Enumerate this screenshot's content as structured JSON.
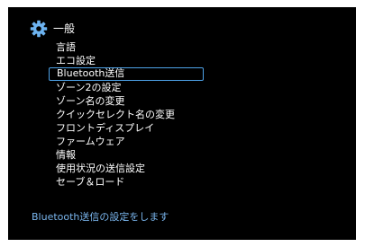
{
  "header": {
    "icon": "gear-icon",
    "title": "一般"
  },
  "menu": {
    "selected_index": 2,
    "items": [
      {
        "label": "言語"
      },
      {
        "label": "エコ設定"
      },
      {
        "label": "Bluetooth送信"
      },
      {
        "label": "ゾーン2の設定"
      },
      {
        "label": "ゾーン名の変更"
      },
      {
        "label": "クイックセレクト名の変更"
      },
      {
        "label": "フロントディスプレイ"
      },
      {
        "label": "ファームウェア"
      },
      {
        "label": "情報"
      },
      {
        "label": "使用状況の送信設定"
      },
      {
        "label": "セーブ＆ロード"
      }
    ]
  },
  "status": {
    "text": "Bluetooth送信の設定をします"
  },
  "colors": {
    "background": "#000000",
    "text": "#ffffff",
    "accent": "#4ea2e8",
    "status_text": "#7ab6ee"
  }
}
